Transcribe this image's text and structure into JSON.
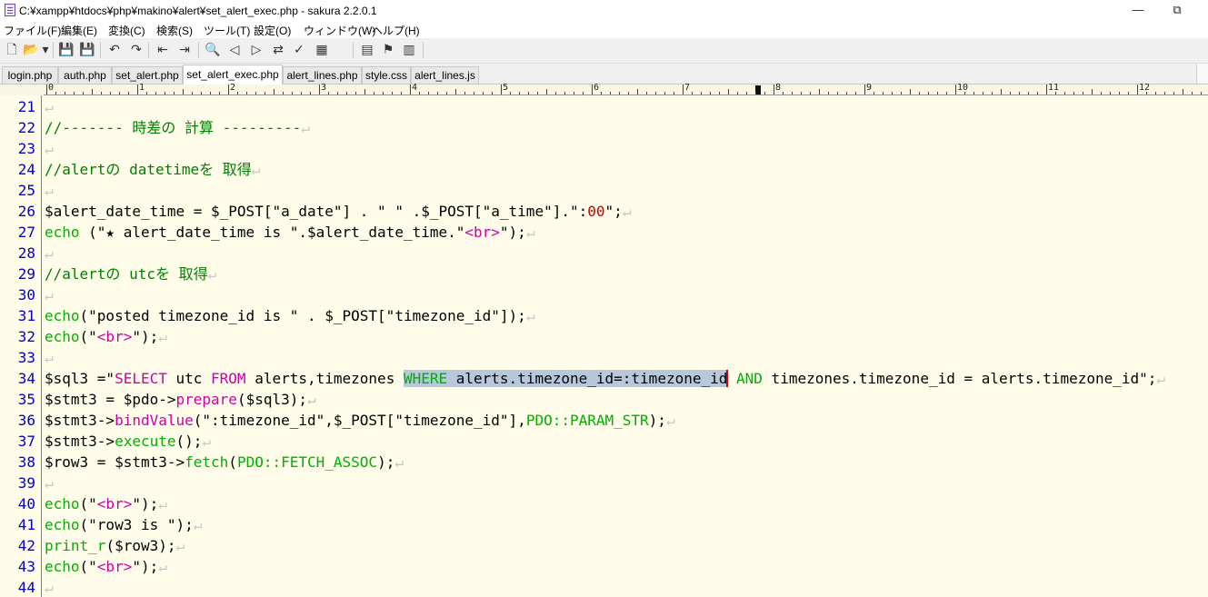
{
  "window": {
    "title": "C:¥xampp¥htdocs¥php¥makino¥alert¥set_alert_exec.php - sakura 2.2.0.1",
    "min_glyph": "—",
    "max_glyph": "⧉"
  },
  "menu": [
    "ファイル(F)",
    "編集(E)",
    "変換(C)",
    "検索(S)",
    "ツール(T)",
    "設定(O)",
    "ウィンドウ(W)",
    "ヘルプ(H)"
  ],
  "toolbar": [
    {
      "icon": "new-file-icon",
      "glyph": "🗋"
    },
    {
      "icon": "open-folder-icon",
      "glyph": "📂"
    },
    {
      "icon": "open-dropdown-icon",
      "glyph": "▾"
    },
    {
      "icon": "save-icon",
      "glyph": "💾"
    },
    {
      "icon": "save-as-icon",
      "glyph": "💾"
    },
    {
      "icon": "undo-icon",
      "glyph": "↶"
    },
    {
      "icon": "redo-icon",
      "glyph": "↷"
    },
    {
      "icon": "jump-back-icon",
      "glyph": "⇤"
    },
    {
      "icon": "jump-forward-icon",
      "glyph": "⇥"
    },
    {
      "icon": "search-icon",
      "glyph": "🔍"
    },
    {
      "icon": "search-prev-icon",
      "glyph": "◁"
    },
    {
      "icon": "search-next-icon",
      "glyph": "▷"
    },
    {
      "icon": "replace-icon",
      "glyph": "⇄"
    },
    {
      "icon": "mark-icon",
      "glyph": "✓"
    },
    {
      "icon": "grep-icon",
      "glyph": "▦"
    },
    {
      "icon": "grep-replace-icon",
      "glyph": "▤"
    },
    {
      "icon": "tag-jump-icon",
      "glyph": "⚑"
    },
    {
      "icon": "settings-icon",
      "glyph": "▥"
    }
  ],
  "tabs": [
    {
      "label": "login.php",
      "active": false
    },
    {
      "label": "auth.php",
      "active": false
    },
    {
      "label": "set_alert.php",
      "active": false
    },
    {
      "label": "set_alert_exec.php",
      "active": true
    },
    {
      "label": "alert_lines.php",
      "active": false
    },
    {
      "label": "style.css",
      "active": false
    },
    {
      "label": "alert_lines.js",
      "active": false
    }
  ],
  "ruler": {
    "labels": [
      "0",
      "1",
      "2",
      "3",
      "4",
      "5",
      "6",
      "7",
      "8",
      "9",
      "10",
      "11",
      "12"
    ]
  },
  "editor": {
    "lines": [
      {
        "num": "21",
        "tokens": []
      },
      {
        "num": "22",
        "tokens": [
          [
            "cm",
            "//------- 時差の 計算 ---------"
          ]
        ]
      },
      {
        "num": "23",
        "tokens": []
      },
      {
        "num": "24",
        "tokens": [
          [
            "cm",
            "//alertの datetimeを 取得"
          ]
        ]
      },
      {
        "num": "25",
        "tokens": []
      },
      {
        "num": "26",
        "tokens": [
          [
            "",
            "$alert_date_time = $_POST[\"a_date\"] . \" \" .$_POST[\"a_time\"].\":"
          ],
          [
            "num",
            "00"
          ],
          [
            "",
            "\";"
          ]
        ]
      },
      {
        "num": "27",
        "tokens": [
          [
            "kw",
            "echo"
          ],
          [
            "",
            " (\"★ alert_date_time is \".$alert_date_time.\""
          ],
          [
            "str",
            "<br>"
          ],
          [
            "",
            "\");"
          ]
        ]
      },
      {
        "num": "28",
        "tokens": []
      },
      {
        "num": "29",
        "tokens": [
          [
            "cm",
            "//alertの utcを 取得"
          ]
        ]
      },
      {
        "num": "30",
        "tokens": []
      },
      {
        "num": "31",
        "tokens": [
          [
            "kw",
            "echo"
          ],
          [
            "",
            "(\"posted timezone_id is \" . $_POST[\"timezone_id\"]);"
          ]
        ]
      },
      {
        "num": "32",
        "tokens": [
          [
            "kw",
            "echo"
          ],
          [
            "",
            "(\""
          ],
          [
            "str",
            "<br>"
          ],
          [
            "",
            "\");"
          ]
        ]
      },
      {
        "num": "33",
        "tokens": []
      },
      {
        "num": "34",
        "tokens": [
          [
            "",
            "$sql3 =\""
          ],
          [
            "str",
            "SELECT"
          ],
          [
            "",
            " utc "
          ],
          [
            "str",
            "FROM"
          ],
          [
            "",
            " alerts,timezones "
          ],
          [
            "kw sel",
            "WHERE"
          ],
          [
            "sel",
            " alerts.timezone_id=:timezone_id"
          ],
          [
            "caret",
            ""
          ],
          [
            "",
            " "
          ],
          [
            "kw",
            "AND"
          ],
          [
            "",
            " timezones.timezone_id = alerts.timezone_id\";"
          ]
        ]
      },
      {
        "num": "35",
        "tokens": [
          [
            "",
            "$stmt3 = $pdo->"
          ],
          [
            "str",
            "prepare"
          ],
          [
            "",
            "($sql3);"
          ]
        ]
      },
      {
        "num": "36",
        "tokens": [
          [
            "",
            "$stmt3->"
          ],
          [
            "str",
            "bindValue"
          ],
          [
            "",
            "(\":timezone_id\",$_POST[\"timezone_id\"],"
          ],
          [
            "kw",
            "PDO::PARAM_STR"
          ],
          [
            "",
            ");"
          ]
        ]
      },
      {
        "num": "37",
        "tokens": [
          [
            "",
            "$stmt3->"
          ],
          [
            "kw",
            "execute"
          ],
          [
            "",
            "();"
          ]
        ]
      },
      {
        "num": "38",
        "tokens": [
          [
            "",
            "$row3 = $stmt3->"
          ],
          [
            "kw",
            "fetch"
          ],
          [
            "",
            "("
          ],
          [
            "kw",
            "PDO::FETCH_ASSOC"
          ],
          [
            "",
            ");"
          ]
        ]
      },
      {
        "num": "39",
        "tokens": []
      },
      {
        "num": "40",
        "tokens": [
          [
            "kw",
            "echo"
          ],
          [
            "",
            "(\""
          ],
          [
            "str",
            "<br>"
          ],
          [
            "",
            "\");"
          ]
        ]
      },
      {
        "num": "41",
        "tokens": [
          [
            "kw",
            "echo"
          ],
          [
            "",
            "(\"row3 is \");"
          ]
        ]
      },
      {
        "num": "42",
        "tokens": [
          [
            "kw",
            "print_r"
          ],
          [
            "",
            "($row3);"
          ]
        ]
      },
      {
        "num": "43",
        "tokens": [
          [
            "kw",
            "echo"
          ],
          [
            "",
            "(\""
          ],
          [
            "str",
            "<br>"
          ],
          [
            "",
            "\");"
          ]
        ]
      },
      {
        "num": "44",
        "tokens": []
      }
    ]
  }
}
